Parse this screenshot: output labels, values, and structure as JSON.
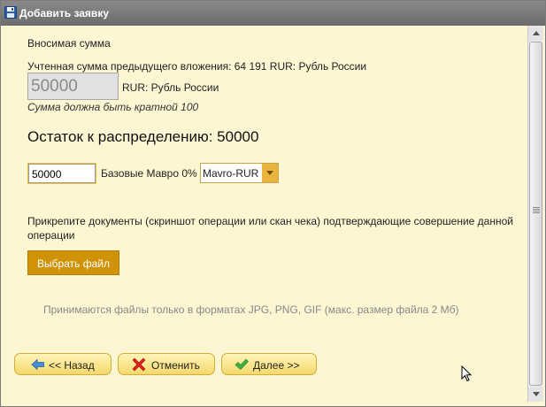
{
  "window": {
    "title": "Добавить заявку",
    "icon": "save-disk-icon"
  },
  "form": {
    "amount_label": "Вносимая сумма",
    "prev_investment_text": "Учтенная сумма предыдущего вложения: 64 191 RUR: Рубль России",
    "amount_value": "50000",
    "amount_currency": "RUR: Рубль России",
    "multiple_hint": "Сумма должна быть кратной 100",
    "remainder_text": "Остаток к распределению: 50000",
    "distribution_value": "50000",
    "distribution_label": "Базовые Мавро 0%",
    "mavro_select": {
      "selected": "Mavro-RUR",
      "accent": "#e9b43b"
    }
  },
  "attachment": {
    "instruction": "Прикрепите документы (скриншот операции или скан чека) подтверждающие совершение данной операции",
    "choose_file_label": "Выбрать файл",
    "choose_file_color": "#d09308",
    "formats_note": "Принимаются файлы только в форматах JPG, PNG, GIF (макс. размер файла 2 Мб)"
  },
  "actions": {
    "back": {
      "label": "<< Назад",
      "icon": "arrow-left-icon"
    },
    "cancel": {
      "label": "Отменить",
      "icon": "red-x-icon"
    },
    "next": {
      "label": "Далее >>",
      "icon": "green-check-icon"
    }
  },
  "colors": {
    "panel_bg": "#fdf6d3",
    "button_gradient_top": "#fff5b8",
    "button_gradient_bottom": "#f3d86b",
    "titlebar": "#7a7a7a"
  }
}
